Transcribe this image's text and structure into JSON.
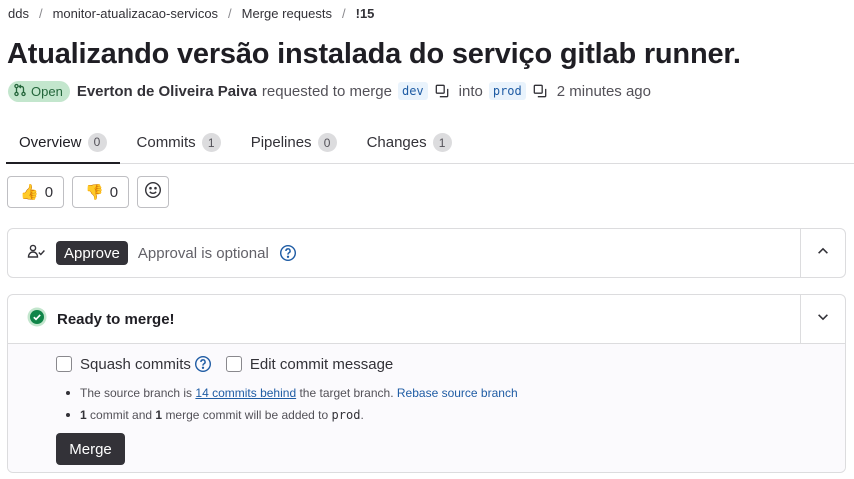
{
  "breadcrumb": [
    "dds",
    "monitor-atualizacao-servicos",
    "Merge requests",
    "!15"
  ],
  "title": "Atualizando versão instalada do serviço gitlab runner.",
  "meta": {
    "status": "Open",
    "author": "Everton de Oliveira Paiva",
    "requested_text": "requested to merge",
    "source_branch": "dev",
    "into_text": "into",
    "target_branch": "prod",
    "time": "2 minutes ago"
  },
  "tabs": [
    {
      "label": "Overview",
      "count": "0"
    },
    {
      "label": "Commits",
      "count": "1"
    },
    {
      "label": "Pipelines",
      "count": "0"
    },
    {
      "label": "Changes",
      "count": "1"
    }
  ],
  "reactions": {
    "thumbs_up": "0",
    "thumbs_down": "0"
  },
  "approval": {
    "button": "Approve",
    "text": "Approval is optional"
  },
  "merge": {
    "title": "Ready to merge!",
    "squash_label": "Squash commits",
    "edit_label": "Edit commit message",
    "info1_prefix": "The source branch is",
    "info1_link": "14 commits behind",
    "info1_mid": "the target branch.",
    "info1_action": "Rebase source branch",
    "info2_n1": "1",
    "info2_a": "commit and",
    "info2_n2": "1",
    "info2_b": "merge commit will be added to",
    "info2_branch": "prod",
    "info2_end": ".",
    "button": "Merge"
  },
  "colors": {
    "open_badge": "#c3e6cd",
    "success": "#108548",
    "button_dark": "#333238",
    "link": "#1f5ca4"
  },
  "icons": [
    "merge-request-icon",
    "copy-icon",
    "thumbs-up-icon",
    "thumbs-down-icon",
    "smiley-icon",
    "approval-user-icon",
    "question-icon",
    "chevron-up-icon",
    "check-circle-icon",
    "chevron-down-icon"
  ]
}
